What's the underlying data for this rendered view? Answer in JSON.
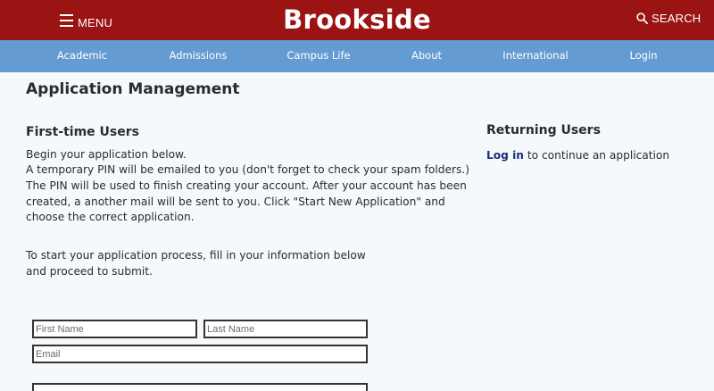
{
  "header": {
    "menu_label": "MENU",
    "brand": "Brookside",
    "search_label": "SEARCH"
  },
  "nav": {
    "items": [
      {
        "label": "Academic"
      },
      {
        "label": "Admissions"
      },
      {
        "label": "Campus Life"
      },
      {
        "label": "About"
      },
      {
        "label": "International"
      },
      {
        "label": "Login"
      }
    ]
  },
  "main": {
    "page_title": "Application Management",
    "first_time": {
      "heading": "First-time Users",
      "intro_lines": [
        "Begin your application below.",
        "A temporary PIN will be emailed to you (don't forget to check your spam folders.)",
        "The PIN will be used to finish creating your account. After your account has been",
        "created, a another mail will be sent to you. Click \"Start New Application\" and",
        "choose the correct application."
      ],
      "instruction_lines": [
        "To start your application process, fill in your information below",
        "and proceed to submit."
      ]
    },
    "returning": {
      "heading": "Returning Users",
      "link_label": "Log in",
      "rest_text": " to continue an application"
    }
  },
  "form": {
    "first_name": {
      "placeholder": "First Name",
      "value": ""
    },
    "last_name": {
      "placeholder": "Last Name",
      "value": ""
    },
    "email": {
      "placeholder": "Email",
      "value": ""
    },
    "next_field": {
      "placeholder": "",
      "value": ""
    }
  },
  "colors": {
    "header_bg": "#9b1414",
    "nav_bg": "#659bd3",
    "page_bg": "#f5f9fc",
    "link": "#1a2f7a"
  }
}
